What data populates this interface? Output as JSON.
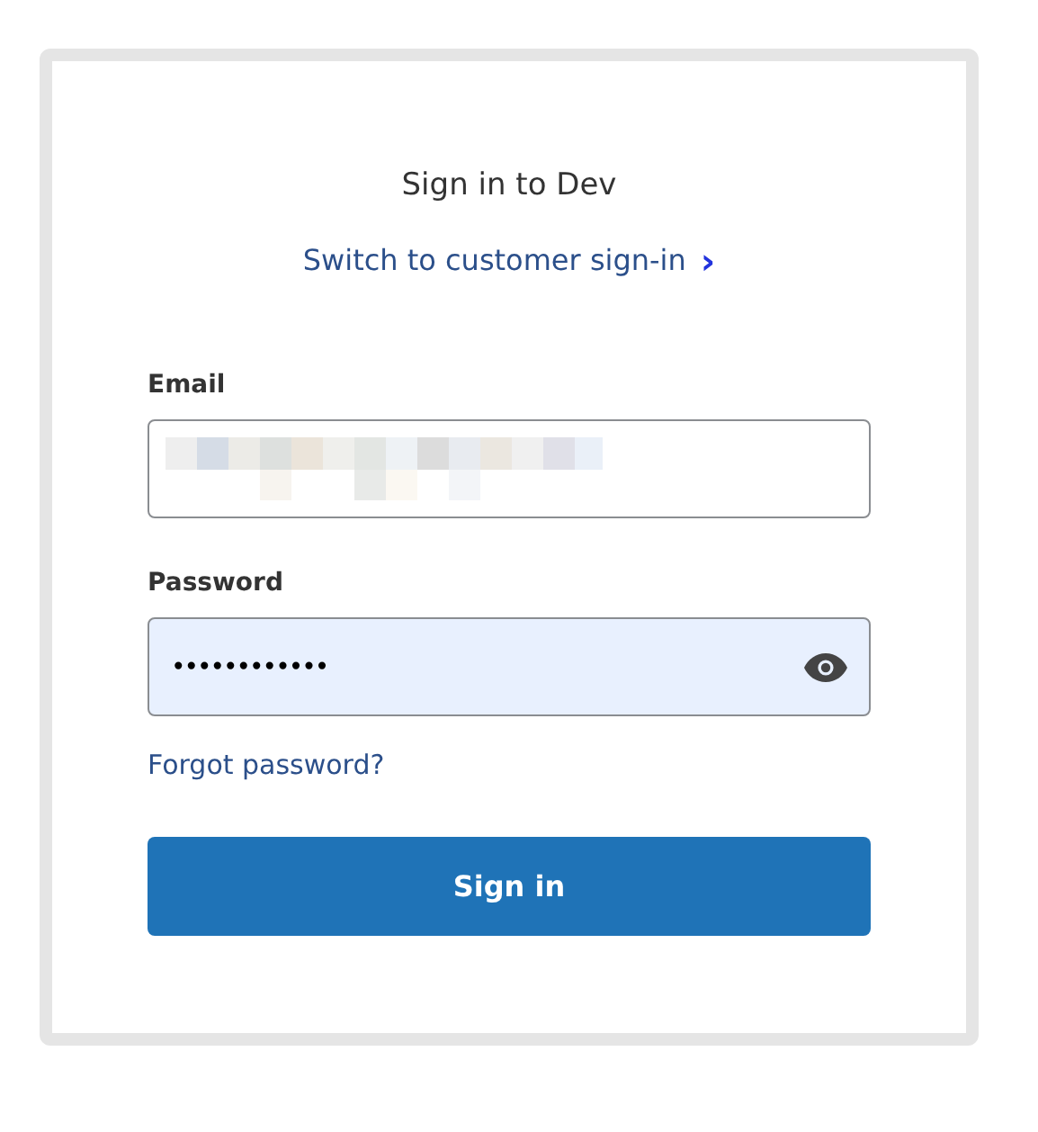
{
  "title": "Sign in to Dev",
  "switch_link": {
    "label": "Switch to customer sign-in",
    "arrow": "›"
  },
  "email": {
    "label": "Email",
    "redacted": true
  },
  "password": {
    "label": "Password",
    "value": "••••••••••••",
    "autofilled": true
  },
  "forgot_link": "Forgot password?",
  "submit_button": "Sign in"
}
